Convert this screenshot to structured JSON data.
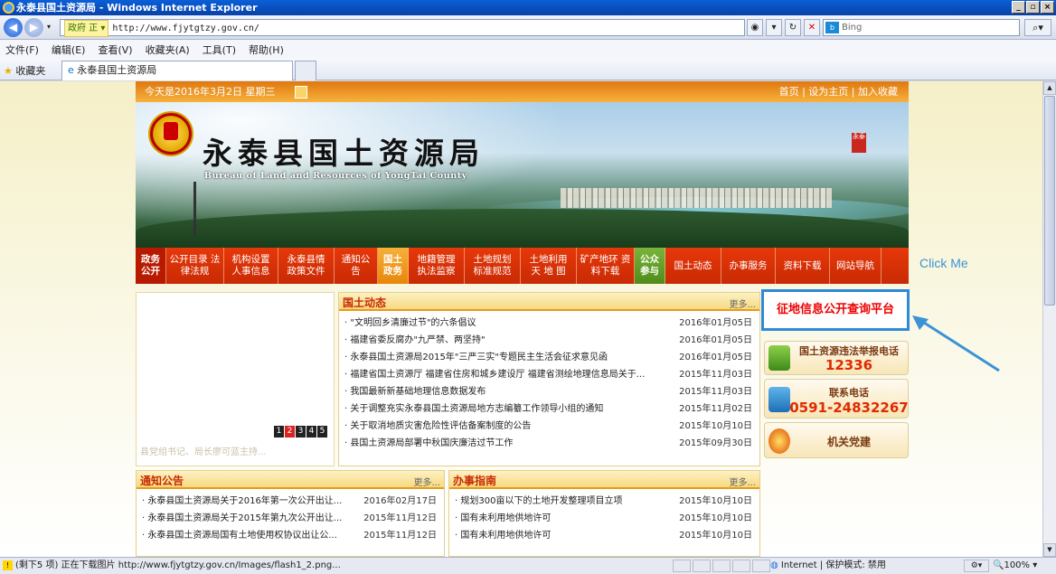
{
  "window": {
    "title": "永泰县国土资源局 - Windows Internet Explorer",
    "buttons": [
      "_",
      "▫",
      "×"
    ]
  },
  "address": {
    "tag": "政府 正 ▾",
    "url": "http://www.fjytgtzy.gov.cn/",
    "search_placeholder": "Bing"
  },
  "menu": [
    "文件(F)",
    "编辑(E)",
    "查看(V)",
    "收藏夹(A)",
    "工具(T)",
    "帮助(H)"
  ],
  "favorites": {
    "label": "收藏夹",
    "tab_title": "永泰县国土资源局"
  },
  "site": {
    "date_text": "今天是2016年3月2日 星期三",
    "top_links": "首页 | 设为主页 | 加入收藏",
    "title": "永泰县国土资源局",
    "subtitle": "Bureau of Land and Resources of YongTai County",
    "nav": [
      {
        "label": "政务 公开",
        "kind": "cat-red"
      },
      {
        "label": "公开目录 法律法规"
      },
      {
        "label": "机构设置 人事信息"
      },
      {
        "label": "永泰县情 政策文件"
      },
      {
        "label": "通知公告"
      },
      {
        "label": "国土 政务",
        "kind": "cat-orange"
      },
      {
        "label": "地籍管理 执法监察"
      },
      {
        "label": "土地规划 标准规范"
      },
      {
        "label": "土地利用 天 地 图"
      },
      {
        "label": "矿产地环 资料下载"
      },
      {
        "label": "公众 参与",
        "kind": "cat-green"
      },
      {
        "label": "国土动态"
      },
      {
        "label": "办事服务"
      },
      {
        "label": "资料下载"
      },
      {
        "label": "网站导航"
      }
    ],
    "click_me": "Click Me",
    "slider": {
      "pages": [
        "1",
        "2",
        "3",
        "4",
        "5"
      ],
      "caption": "县党组书记、局长廖可蓝主持..."
    },
    "news": {
      "title": "国土动态",
      "more": "更多...",
      "items": [
        {
          "text": "· \"文明回乡清廉过节\"的六条倡议",
          "date": "2016年01月05日"
        },
        {
          "text": "· 福建省委反腐办\"九严禁、两坚持\"",
          "date": "2016年01月05日"
        },
        {
          "text": "· 永泰县国土资源局2015年\"三严三实\"专题民主生活会征求意见函",
          "date": "2016年01月05日"
        },
        {
          "text": "· 福建省国土资源厅 福建省住房和城乡建设厅 福建省测绘地理信息局关于...",
          "date": "2015年11月03日"
        },
        {
          "text": "· 我国最新新基础地理信息数据发布",
          "date": "2015年11月03日"
        },
        {
          "text": "· 关于调整充实永泰县国土资源局地方志编纂工作领导小组的通知",
          "date": "2015年11月02日"
        },
        {
          "text": "· 关于取消地质灾害危险性评估备案制度的公告",
          "date": "2015年10月10日"
        },
        {
          "text": "· 县国土资源局部署中秋国庆廉洁过节工作",
          "date": "2015年09月30日"
        }
      ]
    },
    "notice": {
      "title": "通知公告",
      "more": "更多...",
      "items": [
        {
          "text": "· 永泰县国土资源局关于2016年第一次公开出让...",
          "date": "2016年02月17日"
        },
        {
          "text": "· 永泰县国土资源局关于2015年第九次公开出让...",
          "date": "2015年11月12日"
        },
        {
          "text": "· 永泰县国土资源局国有土地使用权协议出让公...",
          "date": "2015年11月12日"
        }
      ]
    },
    "guide": {
      "title": "办事指南",
      "more": "更多...",
      "items": [
        {
          "text": "· 规划300亩以下的土地开发整理项目立项",
          "date": "2015年10月10日"
        },
        {
          "text": "· 国有未利用地供地许可",
          "date": "2015年10月10日"
        },
        {
          "text": "· 国有未利用地供地许可",
          "date": "2015年10月10日"
        }
      ]
    },
    "platform": "征地信息公开查询平台",
    "report": {
      "label": "国土资源违法举报电话",
      "phone": "12336"
    },
    "contact": {
      "label": "联系电话",
      "phone": "0591-24832267"
    },
    "party": {
      "label": "机关党建"
    }
  },
  "status": {
    "text": "(剩下5 项) 正在下载图片 http://www.fjytgtzy.gov.cn/Images/flash1_2.png...",
    "zone": "Internet | 保护模式: 禁用",
    "zoom": "100%"
  },
  "colors": {
    "accent_orange": "#e8860a",
    "nav_red": "#d8330a",
    "link_blue": "#2d8ad8"
  }
}
